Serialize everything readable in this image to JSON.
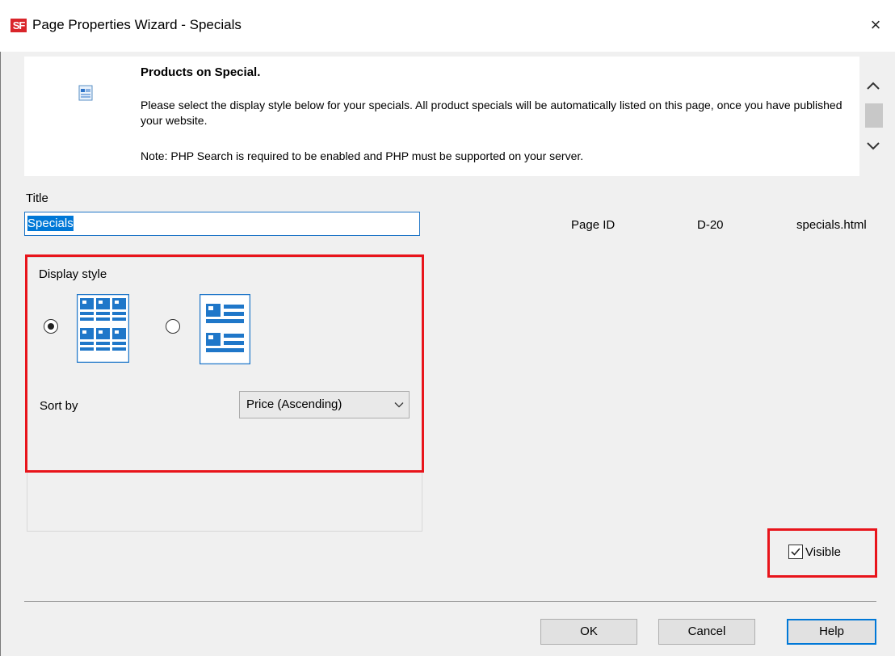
{
  "window": {
    "app_logo": "SF",
    "title": "Page Properties Wizard - Specials",
    "close_glyph": "×"
  },
  "info": {
    "heading": "Products on Special.",
    "text": "Please select the display style below for your specials. All product specials will be automatically listed on this page, once you have published your website.",
    "note": "Note: PHP Search is required to be enabled and PHP must be supported on your server.",
    "icon": "page-icon"
  },
  "form": {
    "title_label": "Title",
    "title_value": "Specials",
    "page_id_label": "Page ID",
    "page_id_value": "D-20",
    "page_file": "specials.html"
  },
  "display_style": {
    "label": "Display style",
    "options": [
      {
        "name": "grid",
        "icon": "grid-layout-icon",
        "selected": true
      },
      {
        "name": "list",
        "icon": "list-layout-icon",
        "selected": false
      }
    ]
  },
  "sort": {
    "label": "Sort by",
    "selected": "Price (Ascending)"
  },
  "visible": {
    "label": "Visible",
    "checked": true
  },
  "buttons": {
    "ok": "OK",
    "cancel": "Cancel",
    "help": "Help"
  },
  "colors": {
    "highlight": "#e8141b",
    "accent": "#0078d7",
    "logo": "#d9252a"
  }
}
